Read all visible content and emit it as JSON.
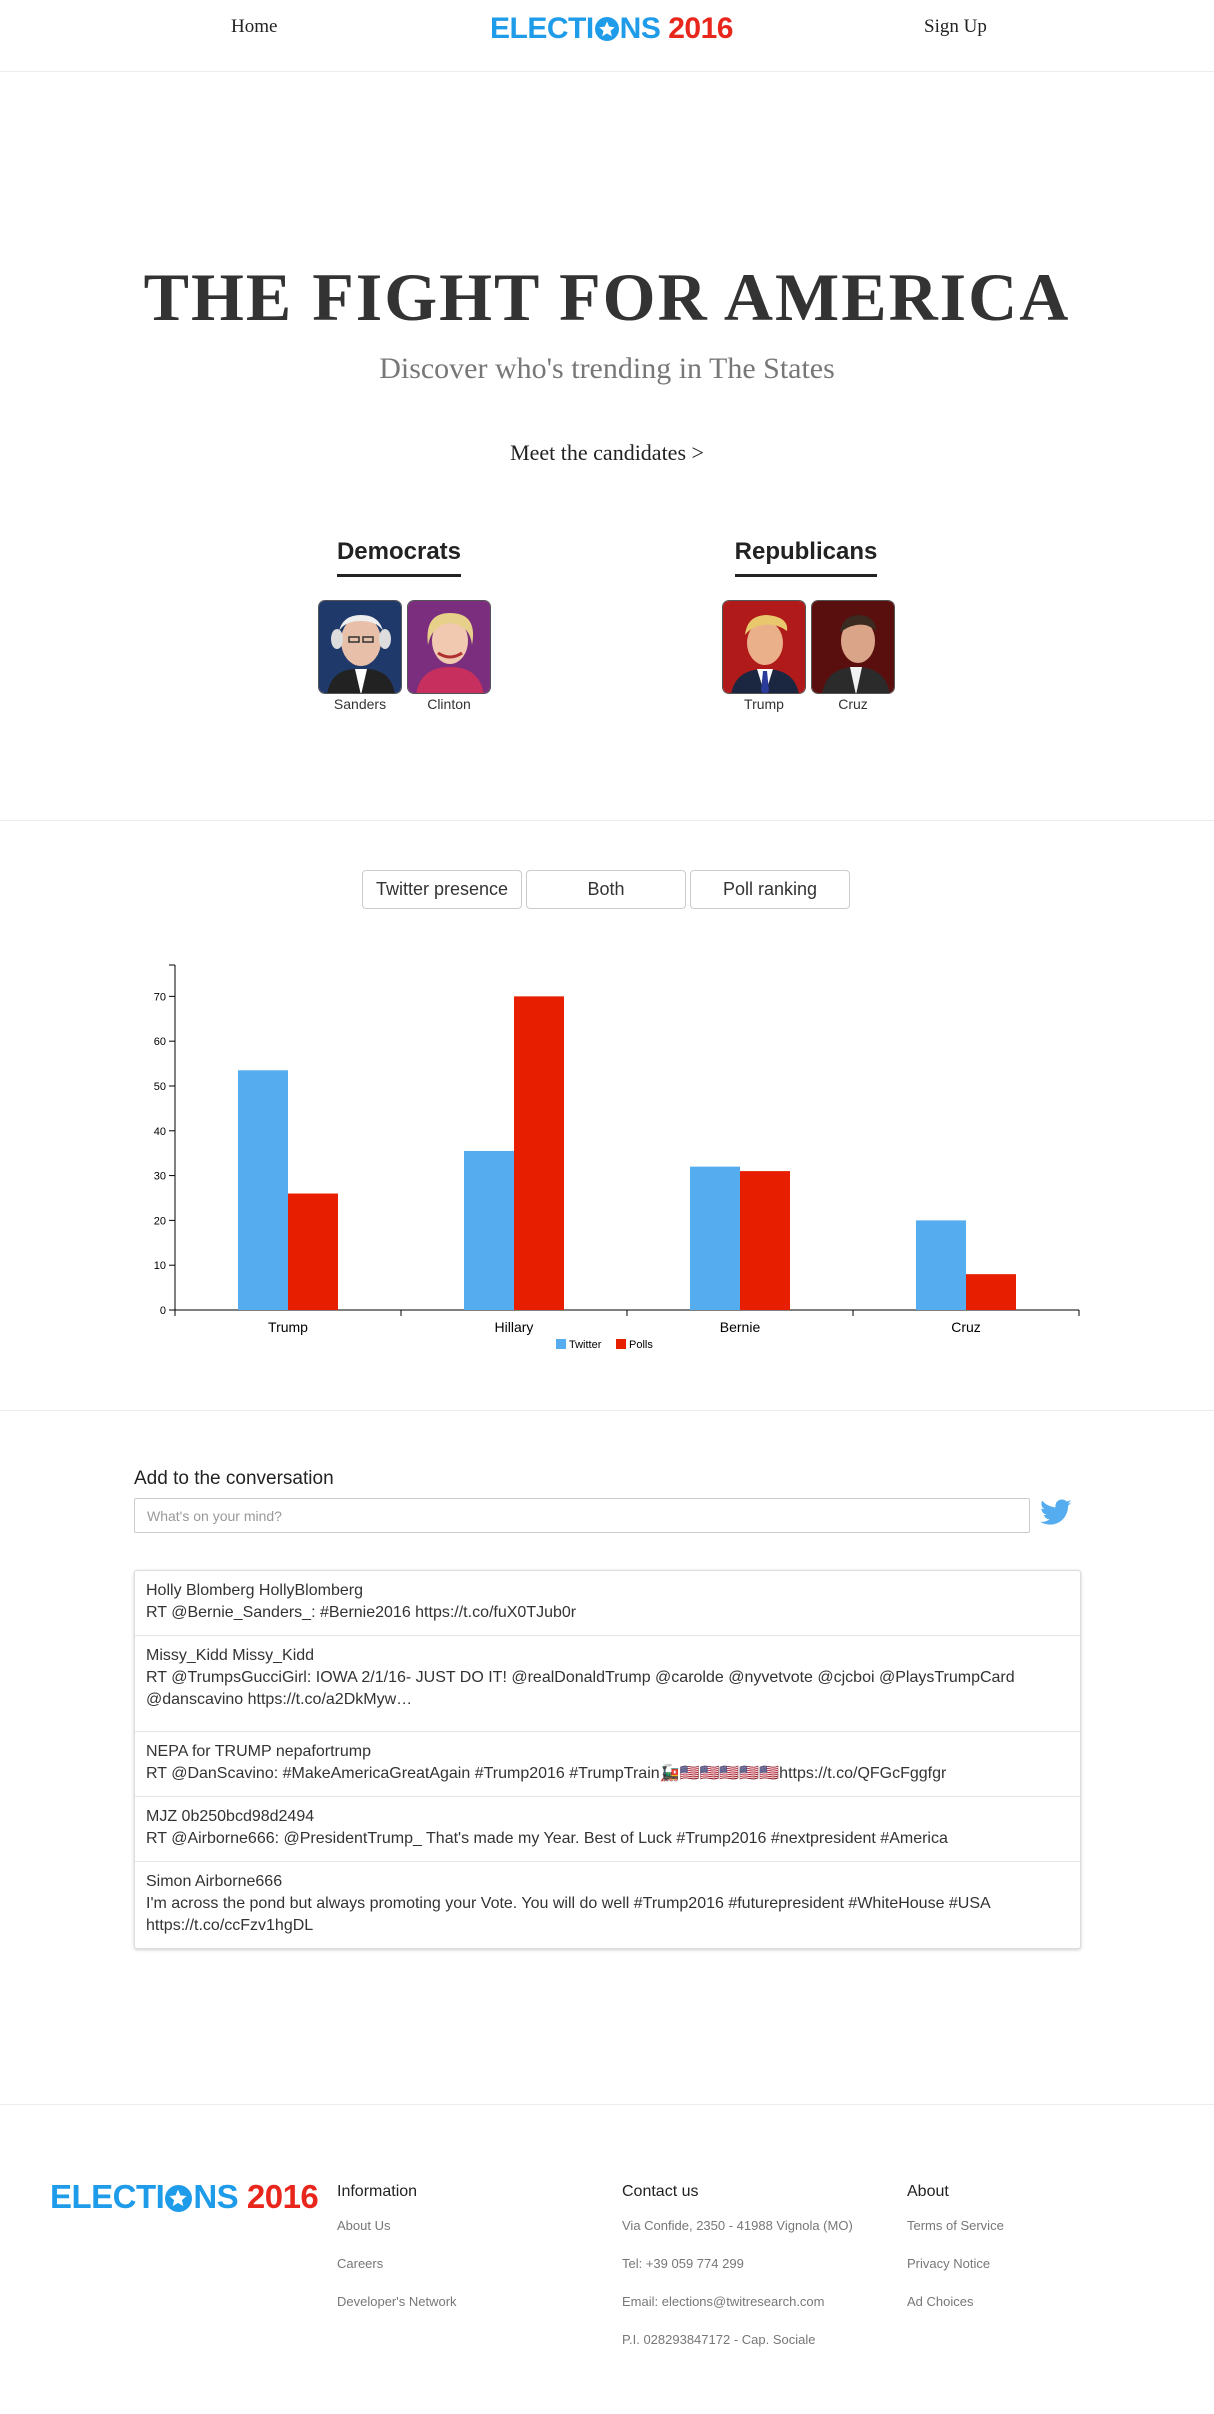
{
  "nav": {
    "home": "Home",
    "signup": "Sign Up",
    "logo_part1": "ELECTI",
    "logo_part2": "NS",
    "logo_year": "2016"
  },
  "hero": {
    "title": "THE FIGHT FOR AMERICA",
    "subtitle": "Discover who's trending in The States",
    "cta": "Meet the candidates >"
  },
  "parties": {
    "democrats": {
      "label": "Democrats",
      "candidates": [
        {
          "name": "Sanders"
        },
        {
          "name": "Clinton"
        }
      ]
    },
    "republicans": {
      "label": "Republicans",
      "candidates": [
        {
          "name": "Trump"
        },
        {
          "name": "Cruz"
        }
      ]
    }
  },
  "toggles": [
    "Twitter presence",
    "Both",
    "Poll ranking"
  ],
  "colors": {
    "twitter": "#55acee",
    "polls": "#e71f00",
    "brand_blue": "#1e9be9",
    "brand_red": "#e9261c"
  },
  "chart_data": {
    "type": "bar",
    "categories": [
      "Trump",
      "Hillary",
      "Bernie",
      "Cruz"
    ],
    "series": [
      {
        "name": "Twitter",
        "values": [
          53.5,
          35.5,
          32,
          20
        ]
      },
      {
        "name": "Polls",
        "values": [
          26,
          70,
          31,
          8
        ]
      }
    ],
    "ylim": [
      0,
      77
    ],
    "yticks": [
      0,
      10,
      20,
      30,
      40,
      50,
      60,
      70
    ],
    "legend_position": "bottom-center",
    "grid": false
  },
  "conversation": {
    "title": "Add to the conversation",
    "placeholder": "What's on your mind?",
    "tweets": [
      {
        "user": "Holly Blomberg HollyBlomberg",
        "text": "RT @Bernie_Sanders_: #Bernie2016 https://t.co/fuX0TJub0r"
      },
      {
        "user": "Missy_Kidd Missy_Kidd",
        "text": "RT @TrumpsGucciGirl: IOWA 2/1/16- JUST DO IT! @realDonaldTrump @carolde @nyvetvote @cjcboi @PlaysTrumpCard @danscavino https://t.co/a2DkMyw…"
      },
      {
        "user": "NEPA for TRUMP nepafortrump",
        "text": "RT @DanScavino: #MakeAmericaGreatAgain #Trump2016 #TrumpTrain🚂🇺🇸🇺🇸🇺🇸🇺🇸🇺🇸https://t.co/QFGcFggfgr"
      },
      {
        "user": "MJZ 0b250bcd98d2494",
        "text": "RT @Airborne666: @PresidentTrump_ That's made my Year. Best of Luck #Trump2016 #nextpresident #America"
      },
      {
        "user": "Simon Airborne666",
        "text": "I'm across the pond but always promoting your Vote. You will do well #Trump2016 #futurepresident #WhiteHouse #USA https://t.co/ccFzv1hgDL"
      }
    ]
  },
  "footer": {
    "information": {
      "title": "Information",
      "items": [
        "About Us",
        "Careers",
        "Developer's Network"
      ]
    },
    "contact": {
      "title": "Contact us",
      "items": [
        "Via Confide, 2350 - 41988 Vignola (MO)",
        "Tel: +39 059 774 299",
        "Email: elections@twitresearch.com",
        "P.I. 028293847172 - Cap. Sociale"
      ]
    },
    "about": {
      "title": "About",
      "items": [
        "Terms of Service",
        "Privacy Notice",
        "Ad Choices"
      ]
    }
  }
}
